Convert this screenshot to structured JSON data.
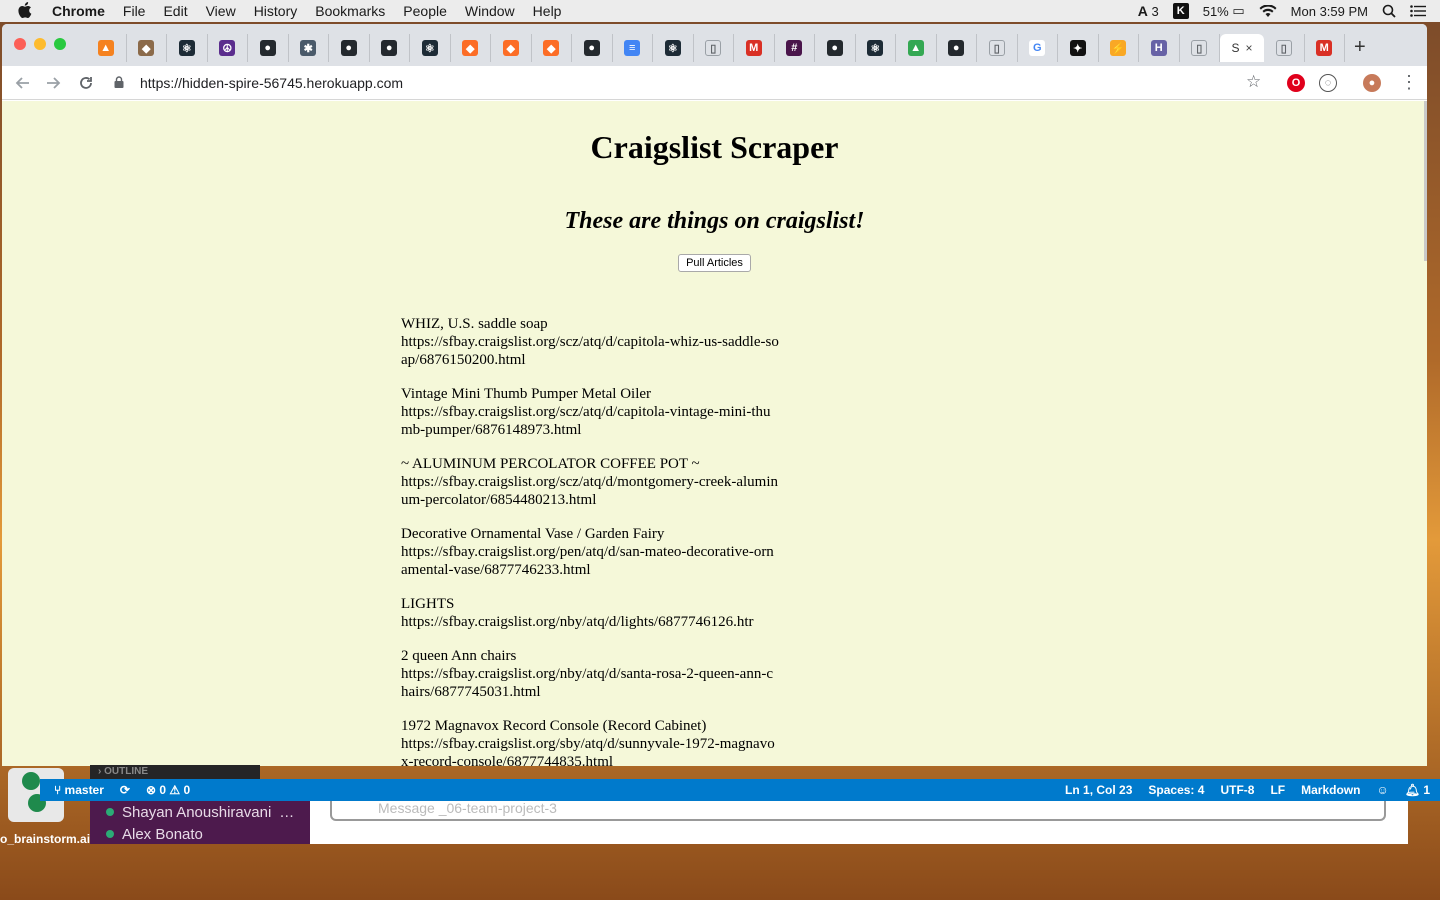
{
  "menubar": {
    "apple": "",
    "items": [
      "Chrome",
      "File",
      "Edit",
      "View",
      "History",
      "Bookmarks",
      "People",
      "Window",
      "Help"
    ],
    "status": {
      "adobe": "3",
      "battery": "51%",
      "clock": "Mon 3:59 PM"
    }
  },
  "browser": {
    "tabs": [
      {
        "icon": "firebase-icon",
        "color": "#f58220",
        "glyph": "▲"
      },
      {
        "icon": "dog-icon",
        "color": "#8b6a4a",
        "glyph": "◆"
      },
      {
        "icon": "react-icon",
        "color": "#1d2b36",
        "glyph": "⚛"
      },
      {
        "icon": "peace-icon",
        "color": "#5b2d8e",
        "glyph": "☮"
      },
      {
        "icon": "github-icon",
        "color": "#24292e",
        "glyph": "●"
      },
      {
        "icon": "settings-icon",
        "color": "#4a5a6a",
        "glyph": "✱"
      },
      {
        "icon": "github-icon",
        "color": "#24292e",
        "glyph": "●"
      },
      {
        "icon": "github-icon",
        "color": "#24292e",
        "glyph": "●"
      },
      {
        "icon": "react-icon",
        "color": "#1d2b36",
        "glyph": "⚛"
      },
      {
        "icon": "gitlab-icon",
        "color": "#fc6d26",
        "glyph": "◆"
      },
      {
        "icon": "gitlab-icon",
        "color": "#fc6d26",
        "glyph": "◆"
      },
      {
        "icon": "gitlab-icon",
        "color": "#fc6d26",
        "glyph": "◆"
      },
      {
        "icon": "github-icon",
        "color": "#24292e",
        "glyph": "●"
      },
      {
        "icon": "docs-icon",
        "color": "#4285f4",
        "glyph": "≡"
      },
      {
        "icon": "react-icon",
        "color": "#1d2b36",
        "glyph": "⚛"
      },
      {
        "icon": "page-icon",
        "color": "#9aa0a6",
        "glyph": "▯"
      },
      {
        "icon": "gmail-icon",
        "color": "#d93025",
        "glyph": "M"
      },
      {
        "icon": "slack-icon",
        "color": "#4a154b",
        "glyph": "#"
      },
      {
        "icon": "github-icon",
        "color": "#24292e",
        "glyph": "●"
      },
      {
        "icon": "react-icon",
        "color": "#1d2b36",
        "glyph": "⚛"
      },
      {
        "icon": "drive-icon",
        "color": "#34a853",
        "glyph": "▲"
      },
      {
        "icon": "github-icon",
        "color": "#24292e",
        "glyph": "●"
      },
      {
        "icon": "page-icon",
        "color": "#9aa0a6",
        "glyph": "▯"
      },
      {
        "icon": "google-icon",
        "color": "#4285f4",
        "glyph": "G"
      },
      {
        "icon": "app-icon",
        "color": "#111111",
        "glyph": "✦"
      },
      {
        "icon": "bolt-icon",
        "color": "#f9a825",
        "glyph": "⚡"
      },
      {
        "icon": "heroku-icon",
        "color": "#6762a6",
        "glyph": "H"
      },
      {
        "icon": "page-icon",
        "color": "#9aa0a6",
        "glyph": "▯"
      }
    ],
    "active_tab": {
      "label": "S",
      "close": "×"
    },
    "after_active_tabs": [
      {
        "icon": "page-icon",
        "color": "#9aa0a6",
        "glyph": "▯"
      },
      {
        "icon": "gmail-icon",
        "color": "#d93025",
        "glyph": "M"
      }
    ],
    "new_tab": "+",
    "url": "https://hidden-spire-56745.herokuapp.com"
  },
  "page": {
    "title": "Craigslist Scraper",
    "subtitle": "These are things on craigslist!",
    "button_label": "Pull Articles",
    "articles": [
      {
        "title": "WHIZ, U.S. saddle soap",
        "url": "https://sfbay.craigslist.org/scz/atq/d/capitola-whiz-us-saddle-soap/6876150200.html"
      },
      {
        "title": "Vintage Mini Thumb Pumper Metal Oiler",
        "url": "https://sfbay.craigslist.org/scz/atq/d/capitola-vintage-mini-thumb-pumper/6876148973.html"
      },
      {
        "title": "~ ALUMINUM PERCOLATOR COFFEE POT ~",
        "url": "https://sfbay.craigslist.org/scz/atq/d/montgomery-creek-aluminum-percolator/6854480213.html"
      },
      {
        "title": "Decorative Ornamental Vase / Garden Fairy",
        "url": "https://sfbay.craigslist.org/pen/atq/d/san-mateo-decorative-ornamental-vase/6877746233.html"
      },
      {
        "title": "LIGHTS",
        "url": "https://sfbay.craigslist.org/nby/atq/d/lights/6877746126.htr"
      },
      {
        "title": "2 queen Ann chairs",
        "url": "https://sfbay.craigslist.org/nby/atq/d/santa-rosa-2-queen-ann-chairs/6877745031.html"
      },
      {
        "title": "1972 Magnavox Record Console (Record Cabinet)",
        "url": "https://sfbay.craigslist.org/sby/atq/d/sunnyvale-1972-magnavox-record-console/6877744835.html"
      }
    ]
  },
  "editor": {
    "outline_label": "OUTLINE",
    "branch": "master",
    "errors": "0",
    "warnings": "0",
    "position": "Ln 1, Col 23",
    "spaces": "Spaces: 4",
    "encoding": "UTF-8",
    "eol": "LF",
    "language": "Markdown",
    "notifications": "1"
  },
  "slack": {
    "members": [
      "Shayan Anoushiravani",
      "Alex Bonato"
    ],
    "message_placeholder": "Message _06-team-project-3"
  },
  "desktop": {
    "label": "o_brainstorm.ai"
  }
}
